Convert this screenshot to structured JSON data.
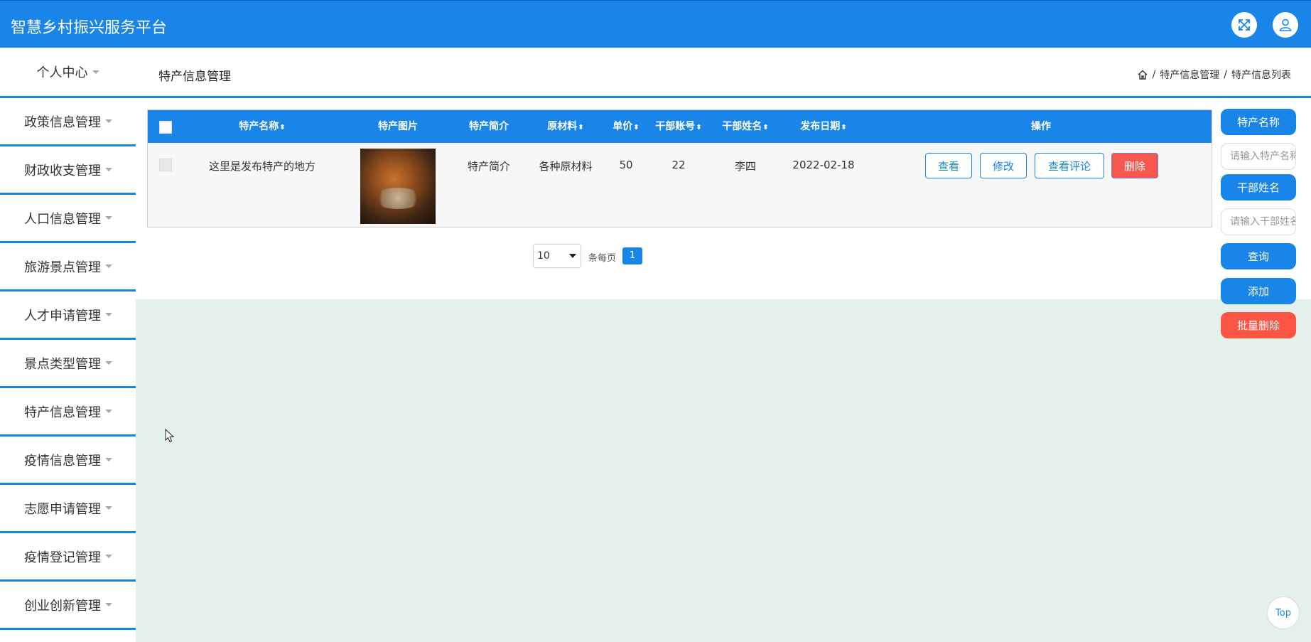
{
  "header": {
    "title": "智慧乡村振兴服务平台",
    "icons": [
      "fullscreen-icon",
      "user-icon"
    ],
    "color": "#1a85e8"
  },
  "sidebar": {
    "head": "个人中心",
    "items": [
      {
        "label": "政策信息管理"
      },
      {
        "label": "财政收支管理"
      },
      {
        "label": "人口信息管理"
      },
      {
        "label": "旅游景点管理"
      },
      {
        "label": "人才申请管理"
      },
      {
        "label": "景点类型管理"
      },
      {
        "label": "特产信息管理"
      },
      {
        "label": "疫情信息管理"
      },
      {
        "label": "志愿申请管理"
      },
      {
        "label": "疫情登记管理"
      },
      {
        "label": "创业创新管理"
      }
    ]
  },
  "page": {
    "title": "特产信息管理",
    "breadcrumb": [
      "特产信息管理",
      "特产信息列表"
    ],
    "breadcrumb_sep": "/"
  },
  "table": {
    "columns": [
      "特产名称",
      "特产图片",
      "特产简介",
      "原材料",
      "单价",
      "干部账号",
      "干部姓名",
      "发布日期",
      "操作"
    ],
    "rows": [
      {
        "name": "这里是发布特产的地方",
        "image": "food-photo",
        "intro": "特产简介",
        "material": "各种原材料",
        "price": "50",
        "account": "22",
        "cadre": "李四",
        "date": "2022-02-18",
        "actions": [
          "查看",
          "修改",
          "查看评论",
          "删除"
        ]
      }
    ]
  },
  "pagination": {
    "page_size": "10",
    "per_page_label": "条每页",
    "current_page": "1"
  },
  "search": {
    "name_label": "特产名称",
    "name_placeholder": "请输入特产名称",
    "cadre_label": "干部姓名",
    "cadre_placeholder": "请输入干部姓名",
    "query": "查询",
    "add": "添加",
    "batch_delete": "批量删除"
  },
  "back_to_top": "Top"
}
